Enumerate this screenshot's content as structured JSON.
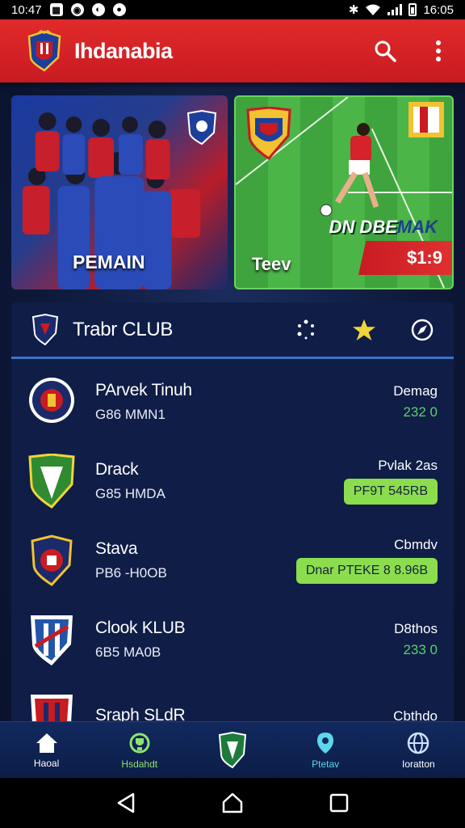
{
  "status_bar": {
    "time": "10:47",
    "right_time": "16:05"
  },
  "app": {
    "title": "Ihdanabia"
  },
  "banners": {
    "left": {
      "label": "PEMAIN"
    },
    "right": {
      "label": "Teev",
      "promo_title_a": "DN DBE",
      "promo_title_b": "MAK",
      "price": "$1:9"
    }
  },
  "club_panel": {
    "title": "Trabr CLUB",
    "rows": [
      {
        "name": "PArvek Tinuh",
        "sub": "G86 MMN1",
        "meta_label": "Demag",
        "meta_value": "232 0",
        "meta_style": "text",
        "logo_color": "#1b2a6b"
      },
      {
        "name": "Drack",
        "sub": "G85 HMDA",
        "meta_label": "Pvlak 2as",
        "meta_value": "PF9T 545RB",
        "meta_style": "pill",
        "logo_color": "#2f8a32"
      },
      {
        "name": "Stava",
        "sub": "PB6 -H0OB",
        "meta_label": "Cbmdv",
        "meta_value": "Dnar PTEKE 8 8.96B",
        "meta_style": "pill",
        "logo_color": "#1b2a6b"
      },
      {
        "name": "Clook KLUB",
        "sub": "6B5 MA0B",
        "meta_label": "D8thos",
        "meta_value": "233 0",
        "meta_style": "text",
        "logo_color": "#2356a8"
      },
      {
        "name": "Sraph SLdR",
        "sub": "",
        "meta_label": "Cbthdo",
        "meta_value": "",
        "meta_style": "text",
        "logo_color": "#c81b22"
      }
    ]
  },
  "bottom_nav": {
    "items": [
      {
        "label": "Haoal",
        "icon": "home-icon"
      },
      {
        "label": "Hsdahdt",
        "icon": "trophy-icon"
      },
      {
        "label": "",
        "icon": "club-shield-icon"
      },
      {
        "label": "Ptetav",
        "icon": "location-icon"
      },
      {
        "label": "Ioratton",
        "icon": "globe-icon"
      }
    ]
  },
  "colors": {
    "app_bar": "#d6222a",
    "panel": "#0f1d47",
    "accent_green": "#8bdd4e",
    "accent_blue": "#3b74c9"
  }
}
